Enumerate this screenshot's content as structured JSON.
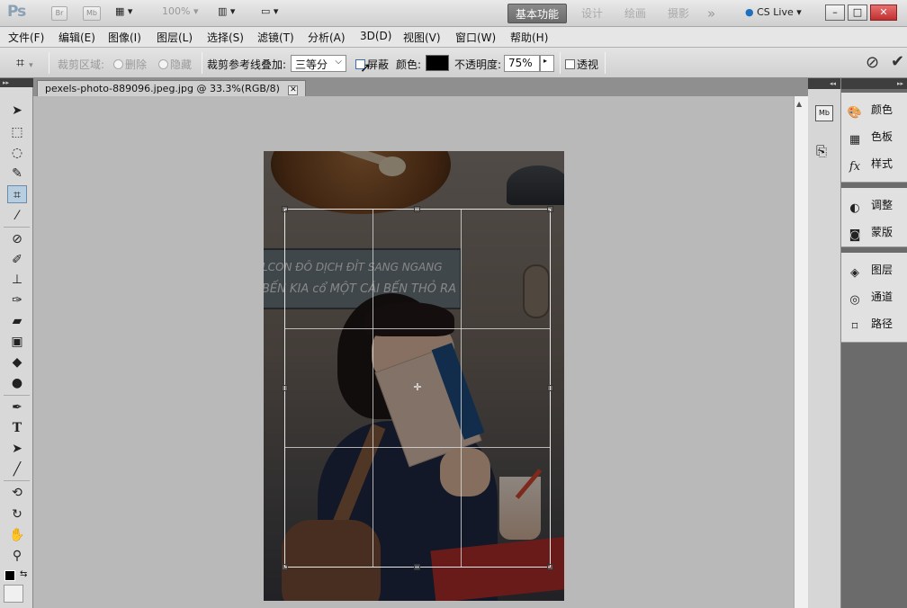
{
  "titlebar": {
    "logo": "Ps",
    "bridge_label": "Br",
    "minibridge_label": "Mb",
    "zoom": "100%",
    "workspaces": [
      "基本功能",
      "设计",
      "绘画",
      "摄影"
    ],
    "more": "»",
    "cs_live": "CS Live",
    "window_buttons": [
      "–",
      "□",
      "✕"
    ]
  },
  "menu": [
    "文件(F)",
    "编辑(E)",
    "图像(I)",
    "图层(L)",
    "选择(S)",
    "滤镜(T)",
    "分析(A)",
    "3D(D)",
    "视图(V)",
    "窗口(W)",
    "帮助(H)"
  ],
  "options": {
    "crop_area_label": "裁剪区域:",
    "delete_label": "删除",
    "hide_label": "隐藏",
    "overlay_label": "裁剪参考线叠加:",
    "overlay_value": "三等分",
    "shield_label": "屏蔽",
    "color_label": "颜色:",
    "shield_color": "#000000",
    "opacity_label": "不透明度:",
    "opacity_value": "75%",
    "perspective_label": "透视",
    "cancel_icon": "⊘",
    "commit_icon": "✔"
  },
  "document": {
    "tab_title": "pexels-photo-889096.jpeg.jpg @ 33.3%(RGB/8)",
    "close": "✕"
  },
  "photo_text": {
    "sign_line1": "LCON ĐÔ DỊCH ĐỈT SANG NGANG",
    "sign_line2": "BẾN KIA cổ MỘT CÁI BẾN THỎ RA"
  },
  "panels": {
    "group1": [
      "颜色",
      "色板",
      "样式"
    ],
    "group2": [
      "调整",
      "蒙版"
    ],
    "group3": [
      "图层",
      "通道",
      "路径"
    ]
  },
  "colors": {
    "workspace_active_bg": "#7a7a7a",
    "selection_handle": "#333333",
    "canvas_bg": "#b9b9b9"
  }
}
